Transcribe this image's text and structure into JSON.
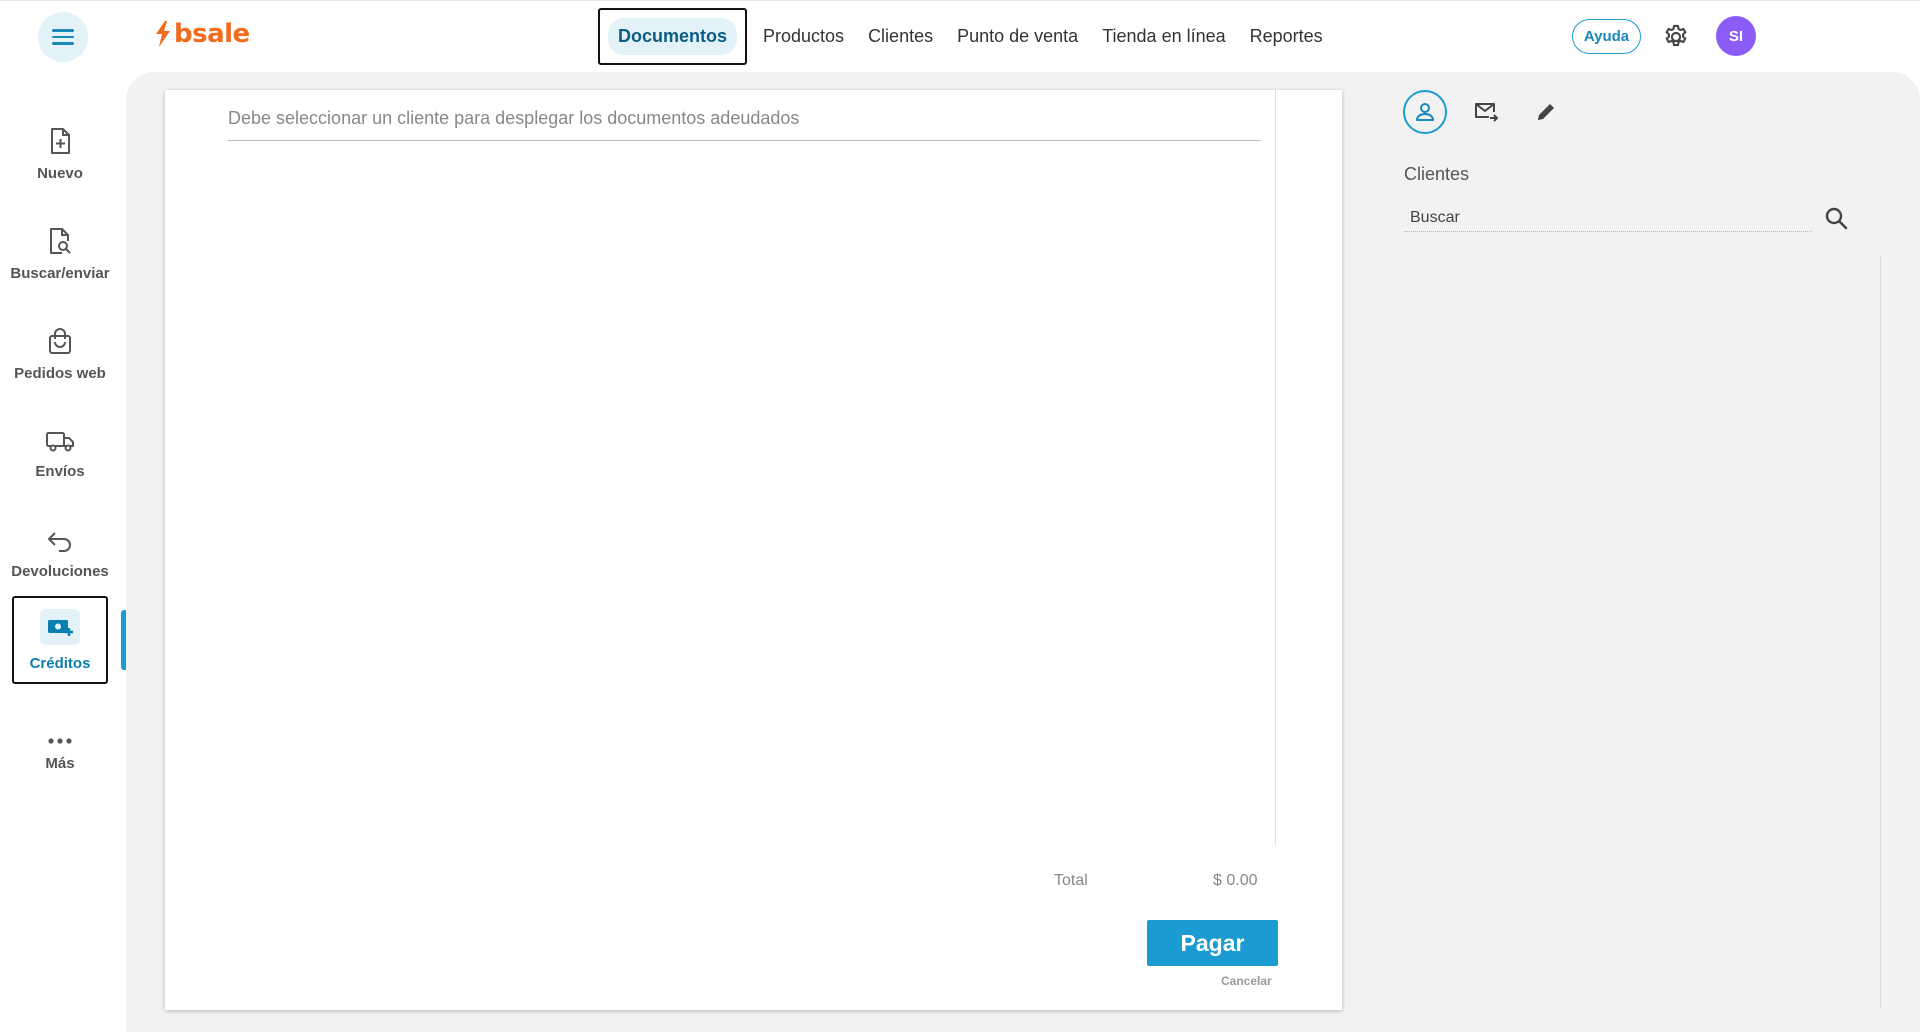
{
  "header": {
    "logo_text": "bsale",
    "nav": [
      {
        "label": "Documentos",
        "active": true
      },
      {
        "label": "Productos"
      },
      {
        "label": "Clientes"
      },
      {
        "label": "Punto de venta"
      },
      {
        "label": "Tienda en línea"
      },
      {
        "label": "Reportes"
      }
    ],
    "help_label": "Ayuda",
    "avatar_initials": "SI",
    "brand_color": "#f26a1b",
    "accent_color": "#1a9bd1",
    "avatar_color": "#8b5cf6"
  },
  "sidebar": {
    "items": [
      {
        "label": "Nuevo",
        "icon": "file-plus-icon"
      },
      {
        "label": "Buscar/enviar",
        "icon": "file-search-icon"
      },
      {
        "label": "Pedidos web",
        "icon": "shopping-bag-icon"
      },
      {
        "label": "Envíos",
        "icon": "truck-icon"
      },
      {
        "label": "Devoluciones",
        "icon": "return-arrow-icon"
      },
      {
        "label": "Créditos",
        "icon": "money-plus-icon",
        "active": true
      },
      {
        "label": "Más",
        "icon": "more-dots-icon"
      }
    ]
  },
  "main": {
    "message": "Debe seleccionar un cliente para desplegar los documentos adeudados",
    "total_label": "Total",
    "total_value": "$ 0.00",
    "pay_label": "Pagar",
    "cancel_label": "Cancelar"
  },
  "right_panel": {
    "tabs": [
      "user-icon",
      "mail-forward-icon",
      "pencil-icon"
    ],
    "clients_title": "Clientes",
    "search_placeholder": "Buscar"
  }
}
